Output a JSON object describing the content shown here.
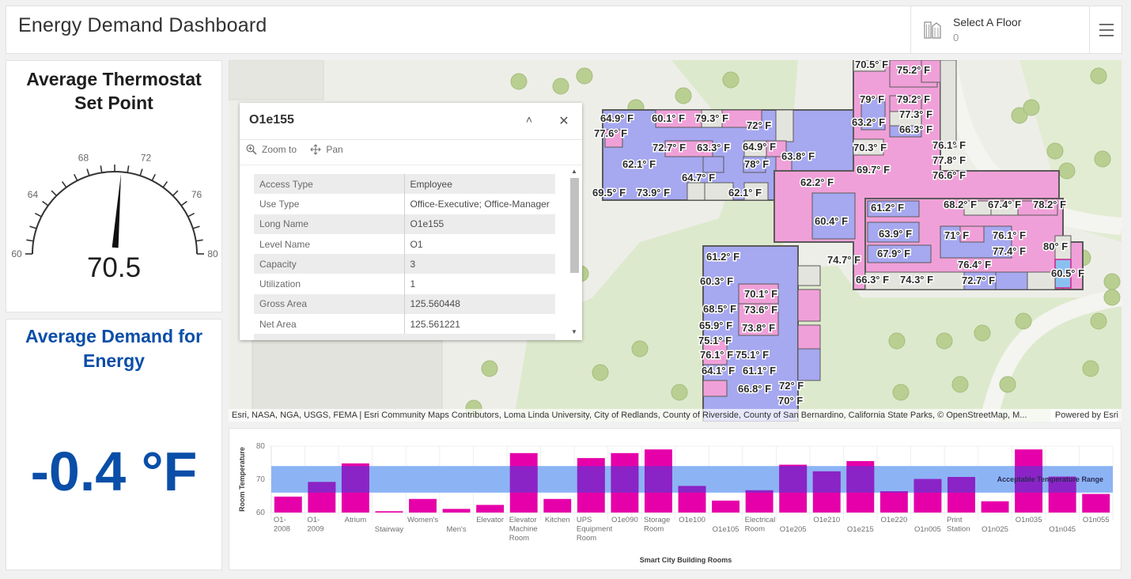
{
  "header": {
    "title": "Energy Demand Dashboard",
    "floor_selector": {
      "label": "Select A Floor",
      "value": "0",
      "icon": "buildings-icon"
    },
    "menu_icon": "hamburger-menu-icon"
  },
  "gauge": {
    "title_line1": "Average Thermostat",
    "title_line2": "Set Point",
    "value": 70.5,
    "value_label": "70.5",
    "min": 60,
    "max": 80,
    "major_ticks": [
      "60",
      "64",
      "68",
      "72",
      "76",
      "80"
    ],
    "minor_tick_step": 1
  },
  "indicator": {
    "title_line1": "Average Demand for",
    "title_line2": "Energy",
    "value": "-0.4 °F",
    "color": "#0a4ea8"
  },
  "map": {
    "attribution": "Esri, NASA, NGA, USGS, FEMA | Esri Community Maps Contributors, Loma Linda University, City of Redlands, County of Riverside, County of San Bernardino, California State Parks, © OpenStreetMap, M...",
    "powered_by": "Powered by Esri",
    "colors": {
      "warm": "#f0a0d8",
      "cool": "#a6a8f0",
      "neutral": "#e4e4de",
      "green": "#dde9cc",
      "tree": "#b9cf92"
    },
    "room_labels": [
      "64.9° F",
      "60.1° F",
      "79.3° F",
      "72° F",
      "77.6° F",
      "72.7° F",
      "63.3° F",
      "64.9° F",
      "63.8° F",
      "62.1° F",
      "78° F",
      "64.7° F",
      "62.2° F",
      "69.5° F",
      "73.9° F",
      "62.1° F",
      "70.5° F",
      "75.2° F",
      "79° F",
      "79.2° F",
      "77.3° F",
      "63.2° F",
      "66.3° F",
      "70.3° F",
      "76.1° F",
      "77.8° F",
      "69.7° F",
      "76.6° F",
      "60.4° F",
      "61.2° F",
      "68.2° F",
      "67.4° F",
      "78.2° F",
      "63.9° F",
      "71° F",
      "76.1° F",
      "77.4° F",
      "80° F",
      "67.9° F",
      "74.7° F",
      "76.4° F",
      "60.5° F",
      "66.3° F",
      "74.3° F",
      "72.7° F",
      "61.2° F",
      "60.3° F",
      "70.1° F",
      "68.5° F",
      "73.6° F",
      "65.9° F",
      "73.8° F",
      "75.1° F",
      "76.1° F",
      "75.1° F",
      "64.1° F",
      "61.1° F",
      "66.8° F",
      "72° F",
      "70° F"
    ]
  },
  "popup": {
    "title": "O1e155",
    "collapse_icon": "chevron-up-icon",
    "close_icon": "close-icon",
    "actions": [
      {
        "label": "Zoom to",
        "icon": "zoom-in-icon"
      },
      {
        "label": "Pan",
        "icon": "pan-arrows-icon"
      }
    ],
    "attributes": [
      {
        "field": "Access Type",
        "value": "Employee"
      },
      {
        "field": "Use Type",
        "value": "Office-Executive; Office-Manager"
      },
      {
        "field": "Long Name",
        "value": "O1e155"
      },
      {
        "field": "Level Name",
        "value": "O1"
      },
      {
        "field": "Capacity",
        "value": "3"
      },
      {
        "field": "Utilization",
        "value": "1"
      },
      {
        "field": "Gross Area",
        "value": "125.560448"
      },
      {
        "field": "Net Area",
        "value": "125.561221"
      }
    ]
  },
  "chart_data": {
    "type": "bar",
    "title": "",
    "xlabel": "Smart City Building Rooms",
    "ylabel": "Room Temperature",
    "ylim": [
      60,
      80
    ],
    "yticks": [
      60,
      70,
      80
    ],
    "grid": true,
    "bar_color": "#e600a9",
    "inside_range_color": "#8a24c6",
    "band": {
      "label": "Acceptable Temperature Range",
      "from": 66,
      "to": 74,
      "color": "#8cb4f5"
    },
    "categories": [
      [
        "O1-",
        "2008"
      ],
      [
        "O1-",
        "2009"
      ],
      [
        "Atrium"
      ],
      [
        "Stairway"
      ],
      [
        "Women's"
      ],
      [
        "Men's"
      ],
      [
        "Elevator"
      ],
      [
        "Elevator",
        "Machine",
        "Room"
      ],
      [
        "Kitchen"
      ],
      [
        "UPS",
        "Equipment",
        "Room"
      ],
      [
        "O1e090"
      ],
      [
        "Storage",
        "Room"
      ],
      [
        "O1e100"
      ],
      [
        "O1e105"
      ],
      [
        "Electrical",
        "Room"
      ],
      [
        "O1e205"
      ],
      [
        "O1e210"
      ],
      [
        "O1e215"
      ],
      [
        "O1e220"
      ],
      [
        "O1n005"
      ],
      [
        "Print",
        "Station"
      ],
      [
        "O1n025"
      ],
      [
        "O1n035"
      ],
      [
        "O1n045"
      ],
      [
        "O1n055"
      ]
    ],
    "values": [
      64.8,
      69.2,
      74.8,
      60.4,
      64.1,
      61.1,
      62.3,
      77.9,
      64.1,
      76.4,
      77.9,
      79.0,
      68.0,
      63.6,
      66.7,
      74.4,
      72.4,
      75.5,
      66.4,
      70.1,
      70.7,
      63.4,
      79.0,
      70.8,
      65.6
    ]
  }
}
